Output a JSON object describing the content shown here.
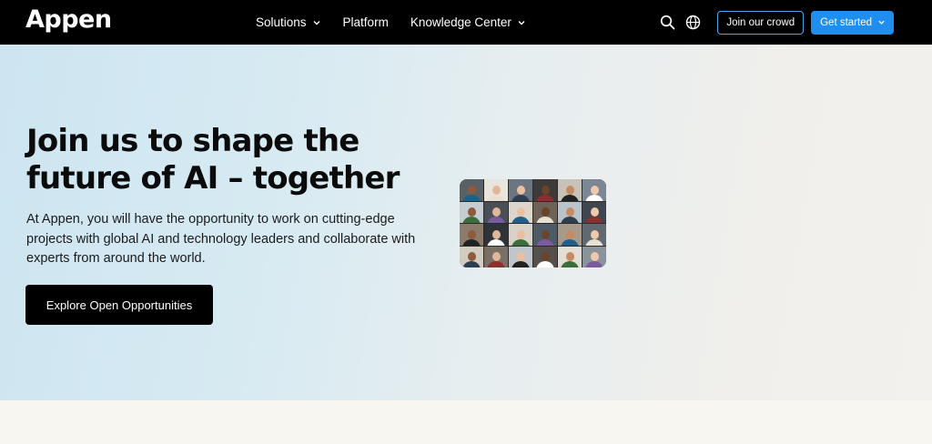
{
  "nav": {
    "logo": "Appen",
    "menu": [
      {
        "label": "Solutions",
        "has_dropdown": true
      },
      {
        "label": "Platform",
        "has_dropdown": false
      },
      {
        "label": "Knowledge Center",
        "has_dropdown": true
      }
    ],
    "search_icon": "search-icon",
    "language_icon": "globe-icon",
    "join_crowd_label": "Join our crowd",
    "get_started_label": "Get started"
  },
  "hero": {
    "title_line1": "Join us to shape the",
    "title_line2": "future of AI – together",
    "description": "At Appen, you will have the opportunity to work on cutting-edge projects with global AI and technology leaders and collaborate with experts from around the world.",
    "cta_label": "Explore Open Opportunities",
    "collage_image": "video-call-participants-grid"
  },
  "colors": {
    "nav_bg": "#000000",
    "accent_blue": "#1e8ef0",
    "cta_bg": "#000000"
  }
}
